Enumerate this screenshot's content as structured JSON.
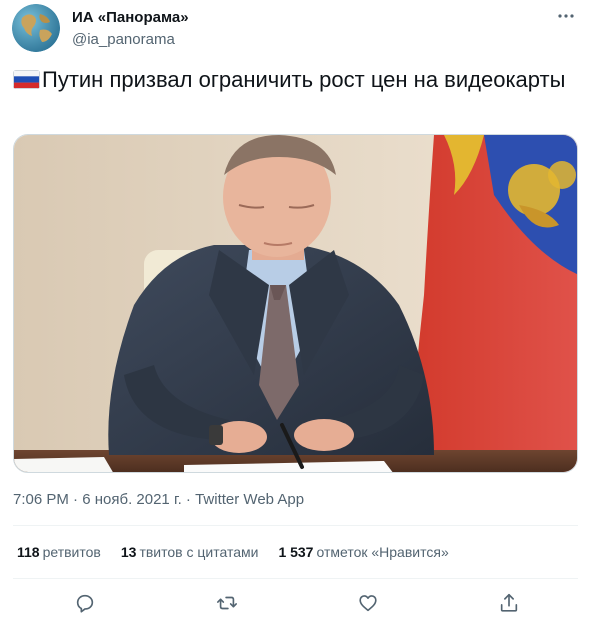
{
  "account": {
    "display_name": "ИА «Панорама»",
    "handle": "@ia_panorama",
    "avatar_icon": "globe-icon"
  },
  "tweet": {
    "flag_icon": "russia-flag-icon",
    "text": "Путин призвал ограничить рост цен на видеокарты"
  },
  "media": {
    "image_icon": "photo-president-signing-document"
  },
  "meta": {
    "time": "7:06 PM",
    "separator": " · ",
    "date": "6 нояб. 2021 г.",
    "source": "Twitter Web App"
  },
  "stats": {
    "retweets_count": "118",
    "retweets_label": "ретвитов",
    "quotes_count": "13",
    "quotes_label": "твитов с цитатами",
    "likes_count": "1 537",
    "likes_label": "отметок «Нравится»"
  },
  "actions": [
    "reply-icon",
    "retweet-icon",
    "like-icon",
    "share-icon"
  ],
  "colors": {
    "text_primary": "#0f1419",
    "text_secondary": "#536471",
    "divider": "#eff3f4",
    "icon": "#536471"
  }
}
